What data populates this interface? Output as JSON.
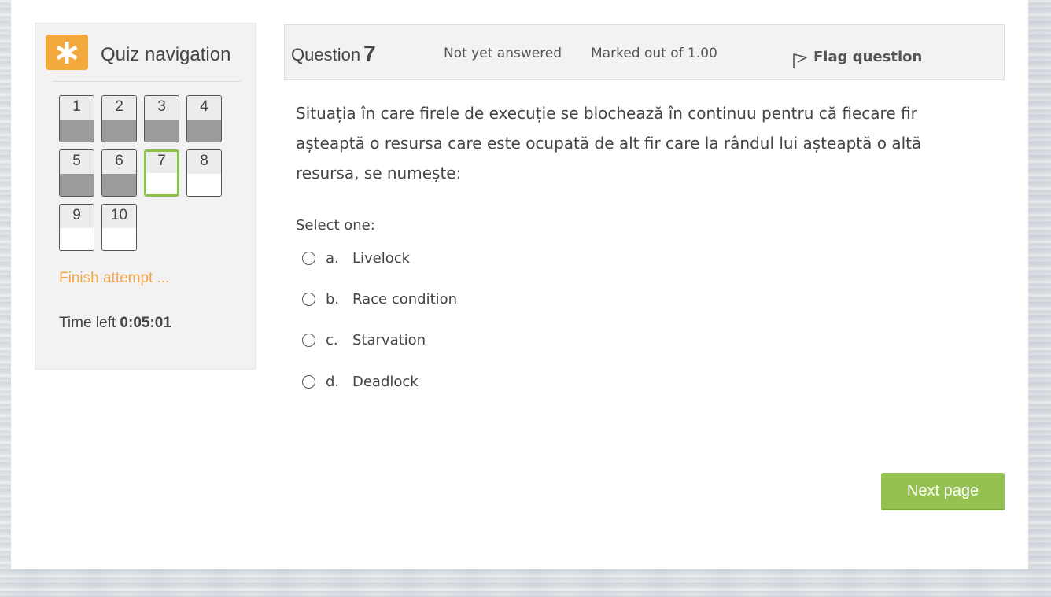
{
  "nav": {
    "title": "Quiz navigation",
    "icon": "asterisk-icon",
    "accent_color": "#f3a93c",
    "questions": [
      {
        "label": "1",
        "state": "answered"
      },
      {
        "label": "2",
        "state": "answered"
      },
      {
        "label": "3",
        "state": "answered"
      },
      {
        "label": "4",
        "state": "answered"
      },
      {
        "label": "5",
        "state": "answered"
      },
      {
        "label": "6",
        "state": "answered"
      },
      {
        "label": "7",
        "state": "current"
      },
      {
        "label": "8",
        "state": "not-answered"
      },
      {
        "label": "9",
        "state": "not-answered"
      },
      {
        "label": "10",
        "state": "not-answered"
      }
    ],
    "finish_label": "Finish attempt ...",
    "time_left_label": "Time left",
    "time_left_value": "0:05:01"
  },
  "question": {
    "label": "Question",
    "number": "7",
    "state": "Not yet answered",
    "mark": "Marked out of 1.00",
    "flag_label": "Flag question",
    "text": "Situația în care firele de execuție se blochează în continuu pentru că fiecare fir așteaptă o resursa care este ocupată de alt fir care la rândul lui așteaptă o altă resursa,  se numește:",
    "select_prompt": "Select one:",
    "answers": [
      {
        "letter": "a.",
        "text": "Livelock"
      },
      {
        "letter": "b.",
        "text": "Race condition"
      },
      {
        "letter": "c.",
        "text": "Starvation"
      },
      {
        "letter": "d.",
        "text": "Deadlock"
      }
    ]
  },
  "actions": {
    "next_label": "Next page",
    "next_color": "#94c150"
  }
}
